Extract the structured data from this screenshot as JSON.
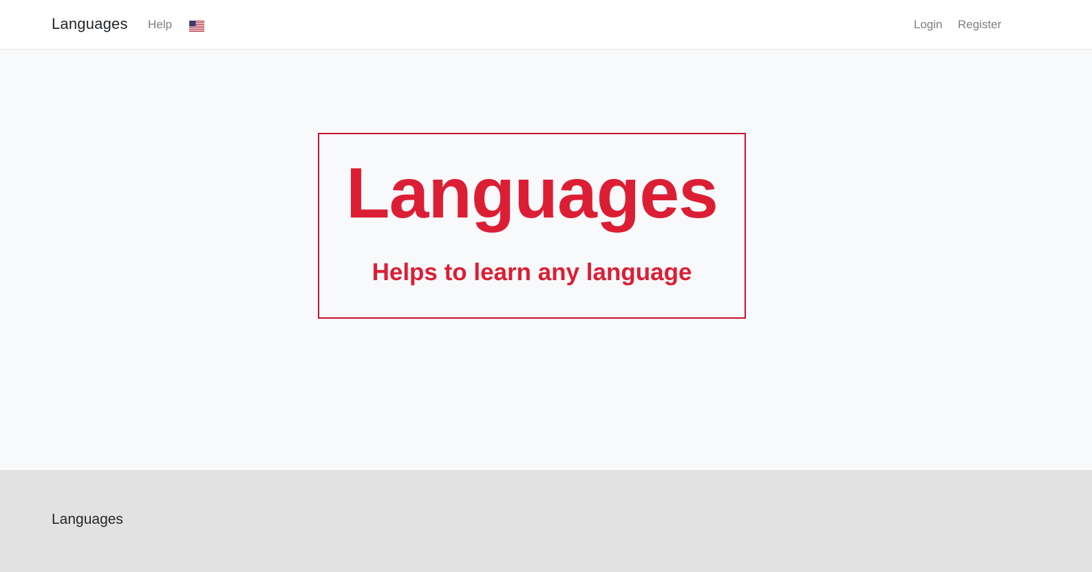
{
  "navbar": {
    "brand": "Languages",
    "help_label": "Help",
    "language_flag_icon": "us-flag-icon",
    "login_label": "Login",
    "register_label": "Register"
  },
  "hero": {
    "title": "Languages",
    "subtitle": "Helps to learn any language"
  },
  "footer": {
    "brand": "Languages"
  },
  "colors": {
    "accent": "#dc1e35",
    "border_accent": "#c8102e",
    "page_background": "#f8f9fa",
    "footer_background": "#e2e2e2",
    "nav_link": "#7d7d7d"
  }
}
